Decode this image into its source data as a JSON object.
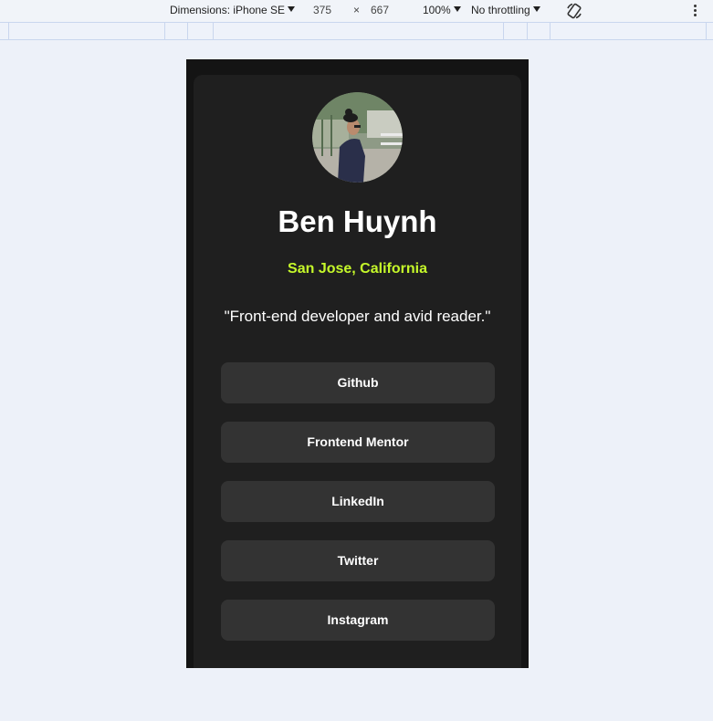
{
  "devtools": {
    "dimensions_label": "Dimensions: iPhone SE",
    "width": "375",
    "times": "×",
    "height": "667",
    "zoom": "100%",
    "throttling": "No throttling",
    "icons": [
      "caret-down-icon",
      "rotate-icon",
      "more-vert-icon"
    ]
  },
  "profile": {
    "avatar_icon": "profile-photo",
    "name": "Ben Huynh",
    "location": "San Jose, California",
    "bio": "\"Front-end developer and avid reader.\""
  },
  "links": [
    {
      "label": "Github"
    },
    {
      "label": "Frontend Mentor"
    },
    {
      "label": "LinkedIn"
    },
    {
      "label": "Twitter"
    },
    {
      "label": "Instagram"
    }
  ],
  "colors": {
    "page_bg": "#edf1f9",
    "device_bg": "#141414",
    "card_bg": "#1f1f1f",
    "button_bg": "#333333",
    "accent": "#c5f82a",
    "text": "#ffffff"
  }
}
